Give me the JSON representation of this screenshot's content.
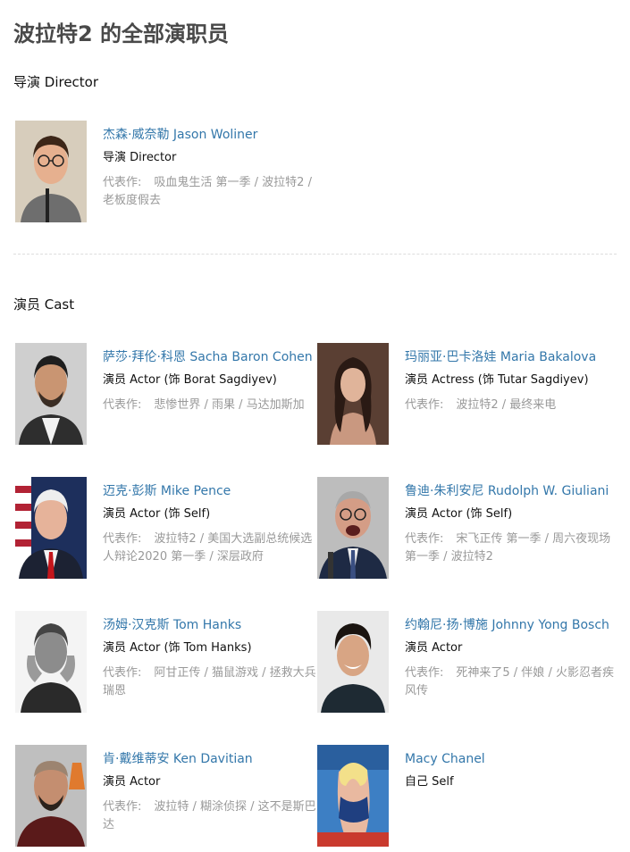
{
  "page": {
    "title": "波拉特2 的全部演职员"
  },
  "sections": {
    "director": {
      "title": "导演 Director"
    },
    "cast": {
      "title": "演员 Cast"
    }
  },
  "works_label": "代表作:",
  "people": [
    {
      "name": "杰森·威奈勒 Jason Woliner",
      "role": "导演 Director",
      "works": "吸血鬼生活 第一季 / 波拉特2 / 老板度假去"
    },
    {
      "name": "萨莎·拜伦·科恩 Sacha Baron Cohen",
      "role": "演员 Actor (饰 Borat Sagdiyev)",
      "works": "悲惨世界 / 雨果 / 马达加斯加"
    },
    {
      "name": "玛丽亚·巴卡洛娃 Maria Bakalova",
      "role": "演员 Actress (饰 Tutar Sagdiyev)",
      "works": "波拉特2 / 最终来电"
    },
    {
      "name": "迈克·彭斯 Mike Pence",
      "role": "演员 Actor (饰 Self)",
      "works": "波拉特2 / 美国大选副总统候选人辩论2020 第一季 / 深层政府"
    },
    {
      "name": "鲁迪·朱利安尼 Rudolph W. Giuliani",
      "role": "演员 Actor (饰 Self)",
      "works": "宋飞正传 第一季 / 周六夜现场 第一季 / 波拉特2"
    },
    {
      "name": "汤姆·汉克斯 Tom Hanks",
      "role": "演员 Actor (饰 Tom Hanks)",
      "works": "阿甘正传 / 猫鼠游戏 / 拯救大兵瑞恩"
    },
    {
      "name": "约翰尼·扬·博施 Johnny Yong Bosch",
      "role": "演员 Actor",
      "works": "死神来了5 / 伴娘 / 火影忍者疾风传"
    },
    {
      "name": "肯·戴维蒂安 Ken Davitian",
      "role": "演员 Actor",
      "works": "波拉特 / 糊涂侦探 / 这不是斯巴达"
    },
    {
      "name": "Macy Chanel",
      "role": "自己 Self",
      "works": ""
    }
  ]
}
